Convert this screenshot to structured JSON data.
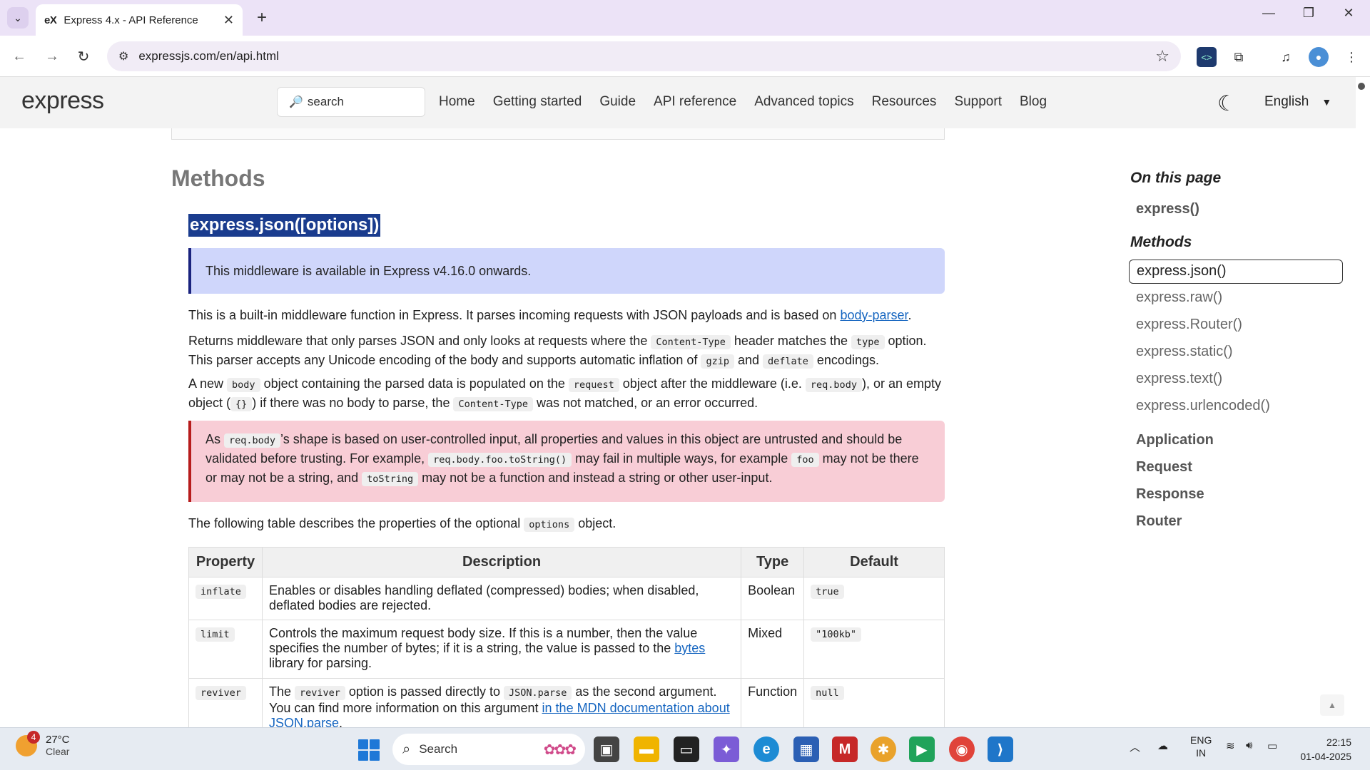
{
  "browser": {
    "tab_title": "Express 4.x - API Reference",
    "tab_favicon": "eX",
    "url": "expressjs.com/en/api.html"
  },
  "site": {
    "logo": "express",
    "search_placeholder": "search",
    "nav": [
      "Home",
      "Getting started",
      "Guide",
      "API reference",
      "Advanced topics",
      "Resources",
      "Support",
      "Blog"
    ],
    "language": "English"
  },
  "main": {
    "section_heading": "Methods",
    "function_title": "express.json([options])",
    "note": "This middleware is available in Express v4.16.0 onwards.",
    "para1": {
      "text": "This is a built-in middleware function in Express. It parses incoming requests with JSON payloads and is based on ",
      "link": "body-parser",
      "end": "."
    },
    "para2": {
      "a": "Returns middleware that only parses JSON and only looks at requests where the ",
      "c1": "Content-Type",
      "b": " header matches the ",
      "c2": "type",
      "c": " option. This parser accepts any Unicode encoding of the body and supports automatic inflation of ",
      "c3": "gzip",
      "d": " and ",
      "c4": "deflate",
      "e": " encodings."
    },
    "para3": {
      "a": "A new ",
      "c1": "body",
      "b": " object containing the parsed data is populated on the ",
      "c2": "request",
      "c": " object after the middleware (i.e. ",
      "c3": "req.body",
      "d": "), or an empty object (",
      "c4": "{}",
      "e": ") if there was no body to parse, the ",
      "c5": "Content-Type",
      "f": " was not matched, or an error occurred."
    },
    "warning": {
      "a": "As ",
      "c1": "req.body",
      "b": "’s shape is based on user-controlled input, all properties and values in this object are untrusted and should be validated before trusting. For example, ",
      "c2": "req.body.foo.toString()",
      "c": " may fail in multiple ways, for example ",
      "c3": "foo",
      "d": " may not be there or may not be a string, and ",
      "c4": "toString",
      "e": " may not be a function and instead a string or other user-input."
    },
    "table_intro": {
      "a": "The following table describes the properties of the optional ",
      "c1": "options",
      "b": " object."
    },
    "table": {
      "headers": [
        "Property",
        "Description",
        "Type",
        "Default"
      ],
      "rows": [
        {
          "property": "inflate",
          "description": "Enables or disables handling deflated (compressed) bodies; when disabled, deflated bodies are rejected.",
          "type": "Boolean",
          "default": "true"
        },
        {
          "property": "limit",
          "description_a": "Controls the maximum request body size. If this is a number, then the value specifies the number of bytes; if it is a string, the value is passed to the ",
          "description_link": "bytes",
          "description_b": " library for parsing.",
          "type": "Mixed",
          "default": "\"100kb\""
        },
        {
          "property": "reviver",
          "description_a": "The ",
          "description_c1": "reviver",
          "description_b": " option is passed directly to ",
          "description_c2": "JSON.parse",
          "description_c": " as the second argument. You can find more information on this argument ",
          "description_link": "in the MDN documentation about JSON.parse",
          "description_d": ".",
          "type": "Function",
          "default": "null"
        }
      ]
    }
  },
  "aside": {
    "heading": "On this page",
    "top_item": "express()",
    "methods_heading": "Methods",
    "methods": [
      "express.json()",
      "express.raw()",
      "express.Router()",
      "express.static()",
      "express.text()",
      "express.urlencoded()"
    ],
    "sections": [
      "Application",
      "Request",
      "Response",
      "Router"
    ]
  },
  "taskbar": {
    "weather_temp": "27°C",
    "weather_desc": "Clear",
    "weather_badge": "4",
    "search_label": "Search",
    "lang_top": "ENG",
    "lang_bottom": "IN",
    "time": "22:15",
    "date": "01-04-2025"
  }
}
